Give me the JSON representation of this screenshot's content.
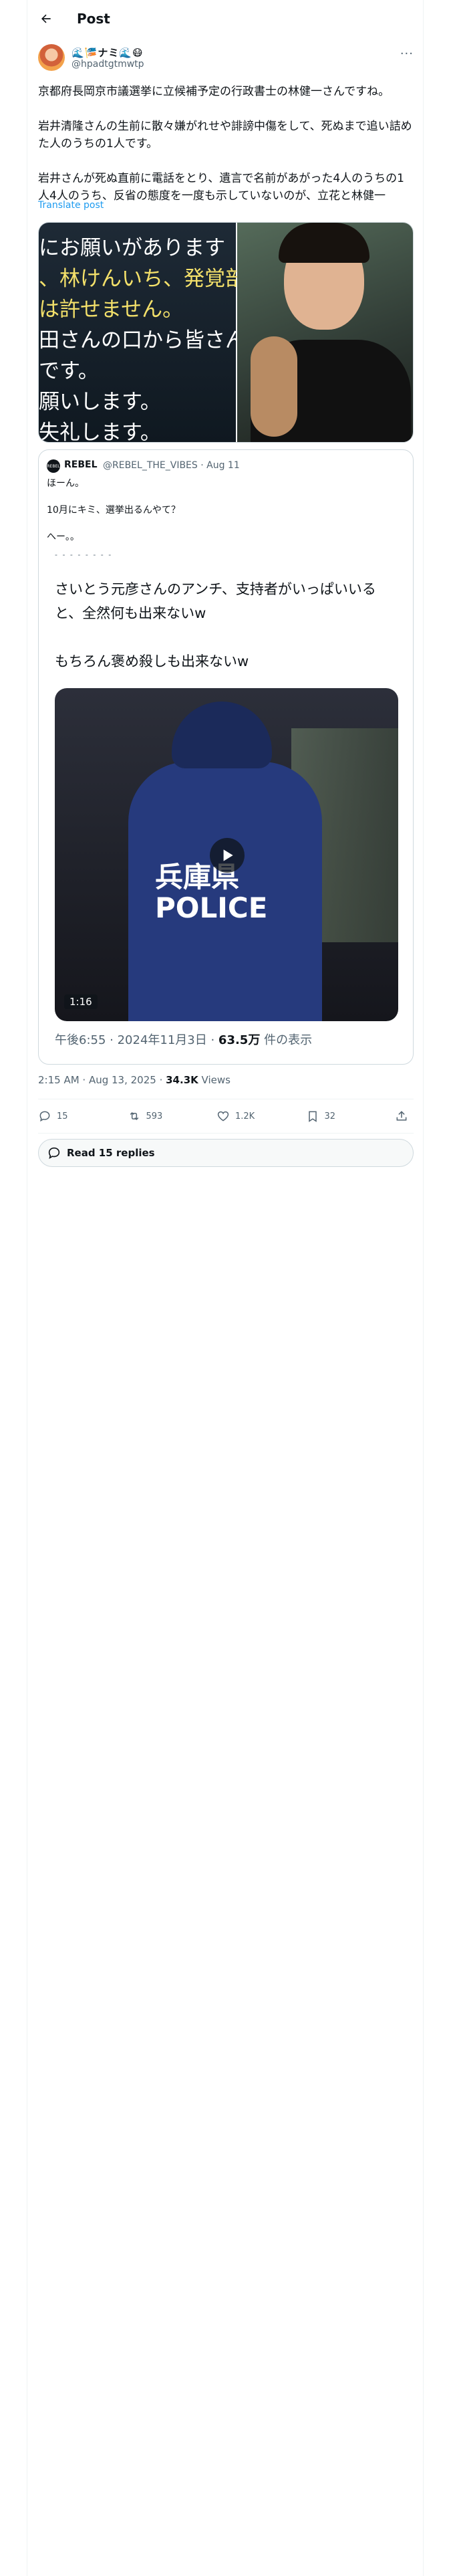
{
  "header": {
    "title": "Post"
  },
  "author": {
    "display_name": "🌊🎏ナミ🌊😷",
    "handle": "@hpadtgtmwtp"
  },
  "post": {
    "paragraphs": [
      "京都府長岡京市議選挙に立候補予定の行政書士の林健一さんですね。",
      "岩井清隆さんの生前に散々嫌がれせや誹謗中傷をして、死ぬまで追い詰めた人のうちの1人です。",
      "岩井さんが死ぬ直前に電話をとり、遺言で名前があがった4人のうちの1人4人のうち、反省の態度を一度も示していないのが、立花と林健一"
    ],
    "translate_label": "Translate post",
    "media_text_lines": [
      "にお願いがあります",
      "、林けんいち、発覚部",
      "は許せません。",
      "田さんの口から皆さん",
      "です。",
      "願いします。",
      "失礼します。"
    ]
  },
  "quoted": {
    "avatar_label": "REBEL",
    "name": "REBEL",
    "handle_date": "@REBEL_THE_VIBES · Aug 11",
    "text_lines": [
      "ほーん。",
      "10月にキミ、選挙出るんやて？",
      "へー。。"
    ],
    "tear_text": "- - - - - - - -",
    "image_lines": [
      "さいとう元彦さんのアンチ、支持者がいっぱいいると、全然何も出来ないw",
      "もちろん褒め殺しも出来ないw"
    ],
    "video_sign": "兵庫県\nPOLICE",
    "duration": "1:16",
    "meta_prefix": "午後6:55 · 2024年11月3日 · ",
    "meta_views_num": "63.5万",
    "meta_views_suffix": " 件の表示"
  },
  "meta": {
    "time_date": "2:15 AM · Aug 13, 2025 · ",
    "views_count": "34.3K",
    "views_label": " Views"
  },
  "actions": {
    "replies": "15",
    "reposts": "593",
    "likes": "1.2K",
    "bookmarks": "32"
  },
  "read_replies_label": "Read 15 replies",
  "colors": {
    "link": "#1d9bf0",
    "muted": "#536471",
    "border": "#cfd9de"
  }
}
